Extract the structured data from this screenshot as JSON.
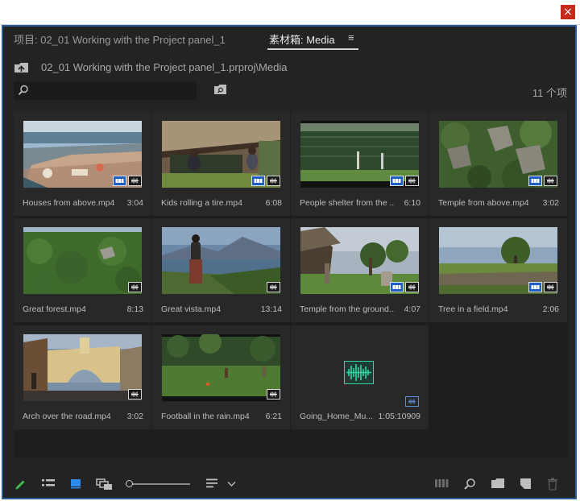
{
  "window": {
    "close_glyph": "×"
  },
  "tabs": [
    {
      "label": "项目: 02_01 Working with the Project panel_1",
      "active": false
    },
    {
      "label": "素材箱: Media",
      "active": true
    }
  ],
  "tab_menu_glyph": "≡",
  "path": "02_01 Working with the Project panel_1.prproj\\Media",
  "search": {
    "placeholder": ""
  },
  "item_count": "11 个项",
  "clips": [
    {
      "name": "Houses from above.mp4",
      "duration": "3:04",
      "thumb": "houses",
      "video_badge": true,
      "audio_badge": true
    },
    {
      "name": "Kids rolling a tire.mp4",
      "duration": "6:08",
      "thumb": "kids",
      "video_badge": true,
      "audio_badge": true
    },
    {
      "name": "People shelter from the ...",
      "duration": "6:10",
      "thumb": "shelter",
      "video_badge": true,
      "audio_badge": true
    },
    {
      "name": "Temple from above.mp4",
      "duration": "3:02",
      "thumb": "temple-above",
      "video_badge": true,
      "audio_badge": true
    },
    {
      "name": "Great forest.mp4",
      "duration": "8:13",
      "thumb": "forest",
      "video_badge": false,
      "audio_badge": true
    },
    {
      "name": "Great vista.mp4",
      "duration": "13:14",
      "thumb": "vista",
      "video_badge": false,
      "audio_badge": true
    },
    {
      "name": "Temple from the ground...",
      "duration": "4:07",
      "thumb": "temple-ground",
      "video_badge": true,
      "audio_badge": true
    },
    {
      "name": "Tree in a field.mp4",
      "duration": "2:06",
      "thumb": "tree",
      "video_badge": true,
      "audio_badge": true
    },
    {
      "name": "Arch over the road.mp4",
      "duration": "3:02",
      "thumb": "arch",
      "video_badge": false,
      "audio_badge": true
    },
    {
      "name": "Football in the rain.mp4",
      "duration": "6:21",
      "thumb": "football",
      "video_badge": false,
      "audio_badge": true
    },
    {
      "name": "Going_Home_Mu...",
      "duration": "1:05:10909",
      "thumb": "audio-only",
      "video_badge": false,
      "audio_badge": true
    }
  ],
  "icons": {
    "folder_up": "folder-up-icon",
    "search": "search-icon",
    "new_bin": "new-bin-icon",
    "bottom": [
      "pencil-icon",
      "list-view-icon",
      "icon-view-icon",
      "freeform-view-icon",
      "zoom-slider",
      "sort-icon",
      "chevron-down-icon",
      "automate-sequence-icon",
      "find-icon",
      "new-bin-icon",
      "new-item-icon",
      "trash-icon"
    ]
  },
  "colors": {
    "panel_bg": "#232323",
    "focus_border": "#2d5b9a",
    "accent_blue": "#2d8ceb",
    "pencil_green": "#3fbf4f",
    "audio_green": "#2fd6a6"
  }
}
